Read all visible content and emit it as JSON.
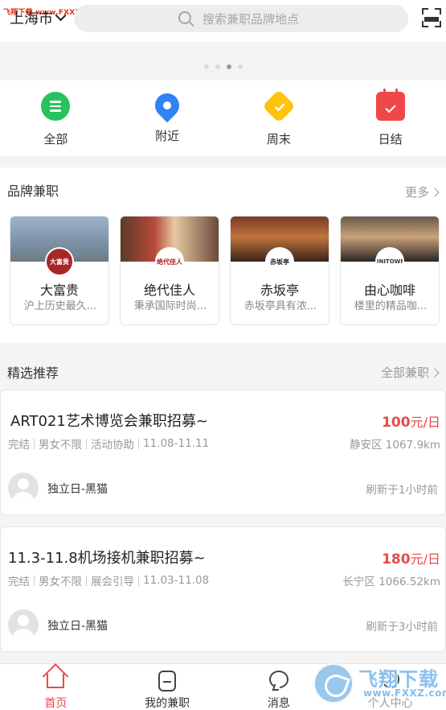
{
  "watermark_top": "飞翔下载 www.FXXZ.com",
  "header": {
    "city": "上海市",
    "search_placeholder": "搜索兼职品牌地点"
  },
  "banner": {
    "dots": 4,
    "active_dot": 3
  },
  "categories": [
    {
      "label": "全部",
      "icon": "list-icon",
      "color": "#27c35a"
    },
    {
      "label": "附近",
      "icon": "location-pin-icon",
      "color": "#2f83f3"
    },
    {
      "label": "周末",
      "icon": "weekend-icon",
      "color": "#ffc20e"
    },
    {
      "label": "日结",
      "icon": "calendar-check-icon",
      "color": "#f04848"
    }
  ],
  "brand": {
    "title": "品牌兼职",
    "more": "更多",
    "cards": [
      {
        "name": "大富贵",
        "desc": "沪上历史最久...",
        "logo": "大富贵"
      },
      {
        "name": "绝代佳人",
        "desc": "秉承国际时尚...",
        "logo": "绝代佳人"
      },
      {
        "name": "赤坂亭",
        "desc": "赤坂亭具有浓...",
        "logo": "赤坂亭"
      },
      {
        "name": "由心咖啡",
        "desc": "楼里的精品咖...",
        "logo": "UNITOWN"
      }
    ]
  },
  "recommend": {
    "title": "精选推荐",
    "more": "全部兼职",
    "jobs": [
      {
        "title": "ART021艺术博览会兼职招募~",
        "wage_num": "100",
        "wage_unit": "元/日",
        "settle": "完结",
        "gender": "男女不限",
        "type": "活动协助",
        "dates": "11.08-11.11",
        "location": "静安区 1067.9km",
        "publisher": "独立日-黑猫",
        "refresh": "刷新于1小时前"
      },
      {
        "title": "11.3-11.8机场接机兼职招募~",
        "wage_num": "180",
        "wage_unit": "元/日",
        "settle": "完结",
        "gender": "男女不限",
        "type": "展会引导",
        "dates": "11.03-11.08",
        "location": "长宁区 1066.52km",
        "publisher": "独立日-黑猫",
        "refresh": "刷新于3小时前"
      }
    ]
  },
  "nav": [
    {
      "label": "首页",
      "icon": "home-icon",
      "active": true
    },
    {
      "label": "我的兼职",
      "icon": "my-jobs-icon",
      "active": false
    },
    {
      "label": "消息",
      "icon": "message-icon",
      "active": false
    },
    {
      "label": "个人中心",
      "icon": "user-icon",
      "active": false
    }
  ],
  "watermark_logo": {
    "title": "飞翔下载",
    "url": "www.FXXZ.com"
  },
  "colors": {
    "accent": "#e84a4a",
    "background": "#f4f4f4"
  }
}
